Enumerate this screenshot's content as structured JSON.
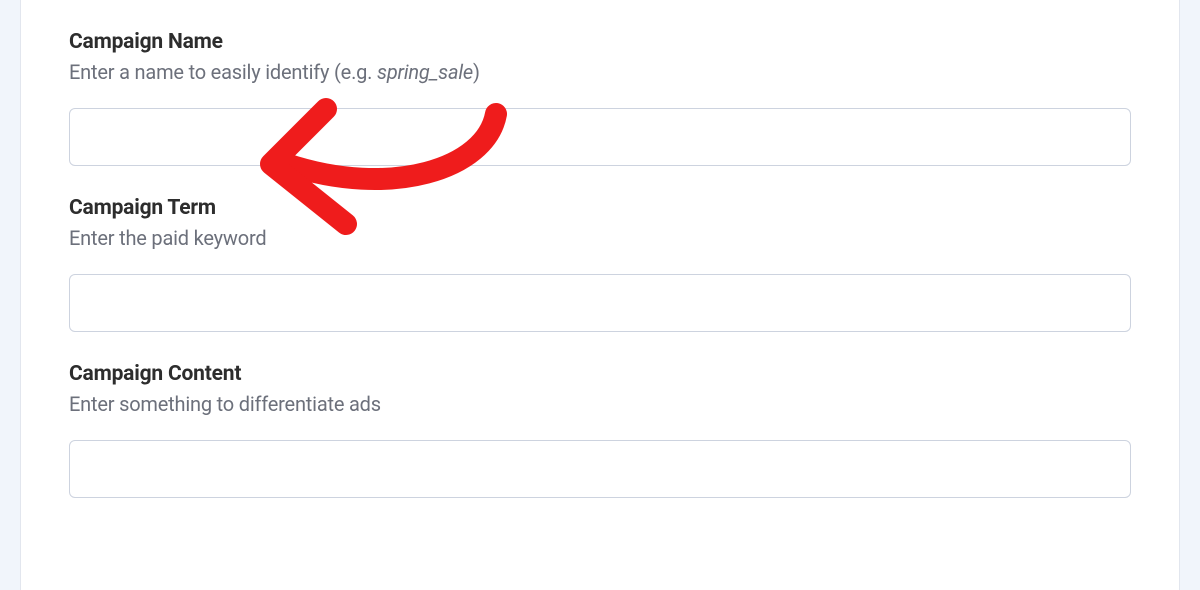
{
  "fields": {
    "campaign_name": {
      "label": "Campaign Name",
      "hint_prefix": "Enter a name to easily identify (e.g. ",
      "hint_example": "spring_sale",
      "hint_suffix": ")",
      "value": ""
    },
    "campaign_term": {
      "label": "Campaign Term",
      "hint": "Enter the paid keyword",
      "value": ""
    },
    "campaign_content": {
      "label": "Campaign Content",
      "hint": "Enter something to differentiate ads",
      "value": ""
    }
  },
  "annotation": {
    "arrow_color": "#ef1c1c"
  }
}
